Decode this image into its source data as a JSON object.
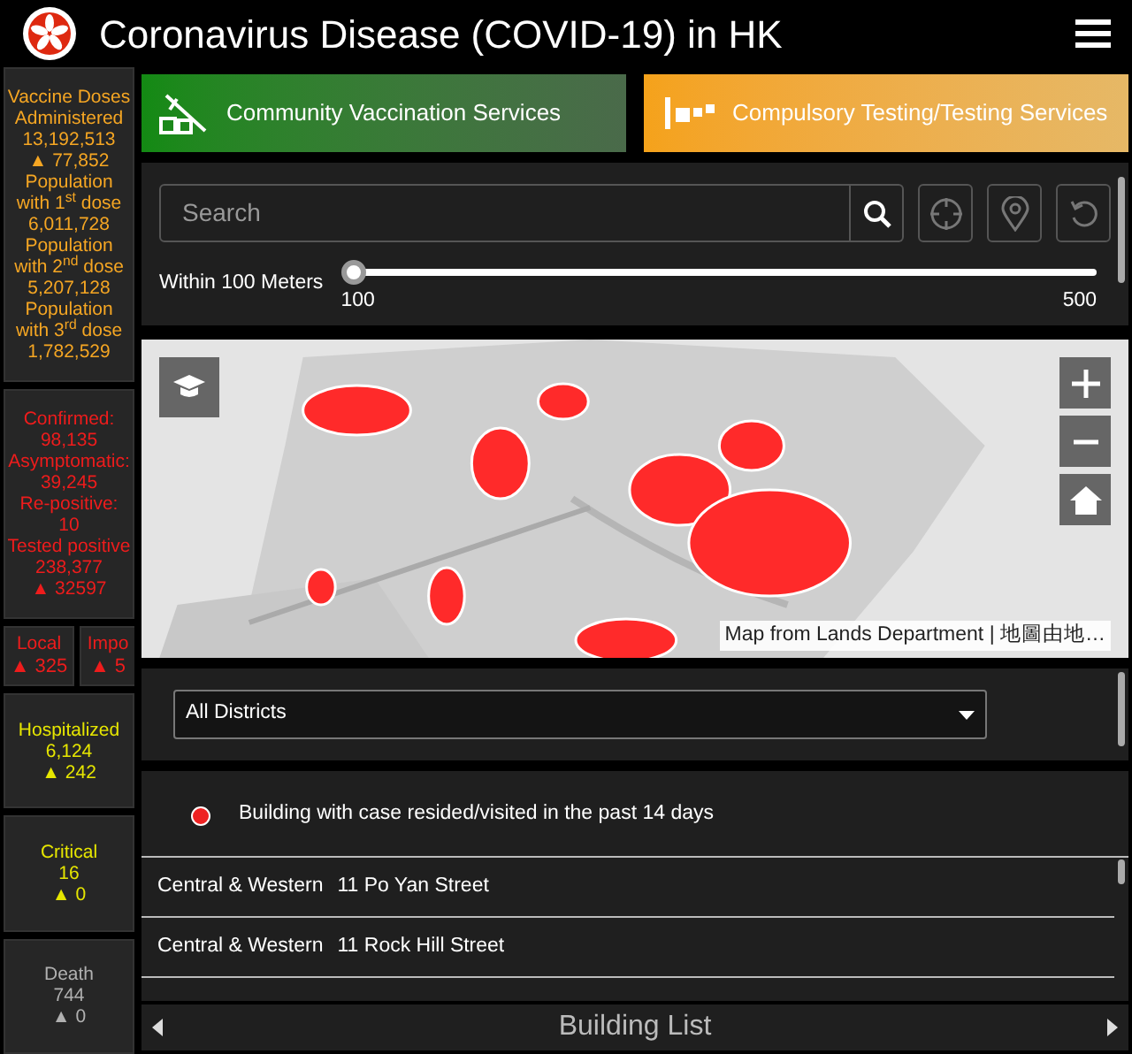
{
  "header": {
    "title": "Coronavirus Disease (COVID-19) in HK"
  },
  "stats": [
    {
      "kind": "card",
      "color": "#f5a623",
      "lines": [
        "Vaccine Doses Administered",
        "13,192,513",
        "▲ 77,852",
        "Population with 1$^{st}$ dose",
        "6,011,728",
        "Population with 2$^{nd}$ dose",
        "5,207,128",
        "Population with 3$^{rd}$ dose",
        "1,782,529"
      ]
    },
    {
      "kind": "card",
      "color": "#ee1c1c",
      "lines": [
        "Confirmed:",
        "98,135",
        "Asymptomatic:",
        "39,245",
        "Re-positive:",
        "10",
        "Tested positive",
        "238,377",
        "▲ 32597"
      ]
    },
    {
      "kind": "pair",
      "color": "#ee1c1c",
      "items": [
        {
          "label": "Local",
          "value": "▲ 325"
        },
        {
          "label": "Impo",
          "value": "▲ 5"
        }
      ]
    },
    {
      "kind": "card",
      "color": "#e6e600",
      "lines": [
        "Hospitalized",
        "6,124",
        "▲ 242"
      ]
    },
    {
      "kind": "card",
      "color": "#e6e600",
      "lines": [
        "Critical",
        "16",
        "▲ 0"
      ]
    },
    {
      "kind": "card",
      "color": "#b0b0b0",
      "lines": [
        "Death",
        "744",
        "▲ 0"
      ]
    }
  ],
  "services": [
    {
      "label": "Community Vaccination Services",
      "kind": "vaccine"
    },
    {
      "label": "Compulsory Testing/Testing Services",
      "kind": "testing"
    }
  ],
  "search": {
    "placeholder": "Search"
  },
  "radius": {
    "label": "Within 100 Meters",
    "level": 0,
    "min": "100",
    "max": "500"
  },
  "map": {
    "attribution": "Map from Lands Department | 地圖由地…"
  },
  "filter": {
    "value": "All Districts"
  },
  "legend": {
    "label": "Building with case resided/visited in the past 14 days",
    "color": "#ee2222"
  },
  "buildings": [
    {
      "district": "Central & Western",
      "address": "11 Po Yan Street"
    },
    {
      "district": "Central & Western",
      "address": "11 Rock Hill Street"
    }
  ],
  "footer": {
    "title": "Building List"
  }
}
